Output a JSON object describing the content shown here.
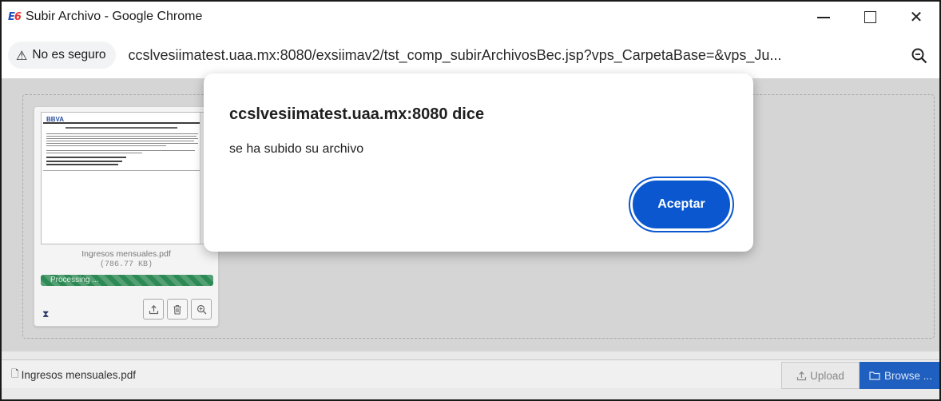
{
  "window": {
    "title": "Subir Archivo - Google Chrome",
    "app_icon_text_a": "E",
    "app_icon_text_b": "6"
  },
  "addressbar": {
    "security_label": "No es seguro",
    "security_icon": "warning-triangle-icon",
    "url": "ccslvesiimatest.uaa.mx:8080/exsiimav2/tst_comp_subirArchivosBec.jsp?vps_CarpetaBase=&vps_Ju..."
  },
  "dialog": {
    "title": "ccslvesiimatest.uaa.mx:8080 dice",
    "message": "se ha subido su archivo",
    "ok_label": "Aceptar"
  },
  "file_card": {
    "thumb_brand": "BBVA",
    "name": "Ingresos mensuales.pdf",
    "size": "(786.77 KB)",
    "status": "Processing ...",
    "progress": 1.0,
    "status_icon": "hourglass-icon",
    "actions": [
      "upload-icon",
      "trash-icon",
      "zoom-in-icon"
    ]
  },
  "bottombar": {
    "selected_file": "Ingresos mensuales.pdf",
    "upload_label": "Upload",
    "browse_label": "Browse ..."
  },
  "colors": {
    "accent": "#0b57d0",
    "progress": "#2e8a55",
    "browse": "#1f5fbf"
  }
}
